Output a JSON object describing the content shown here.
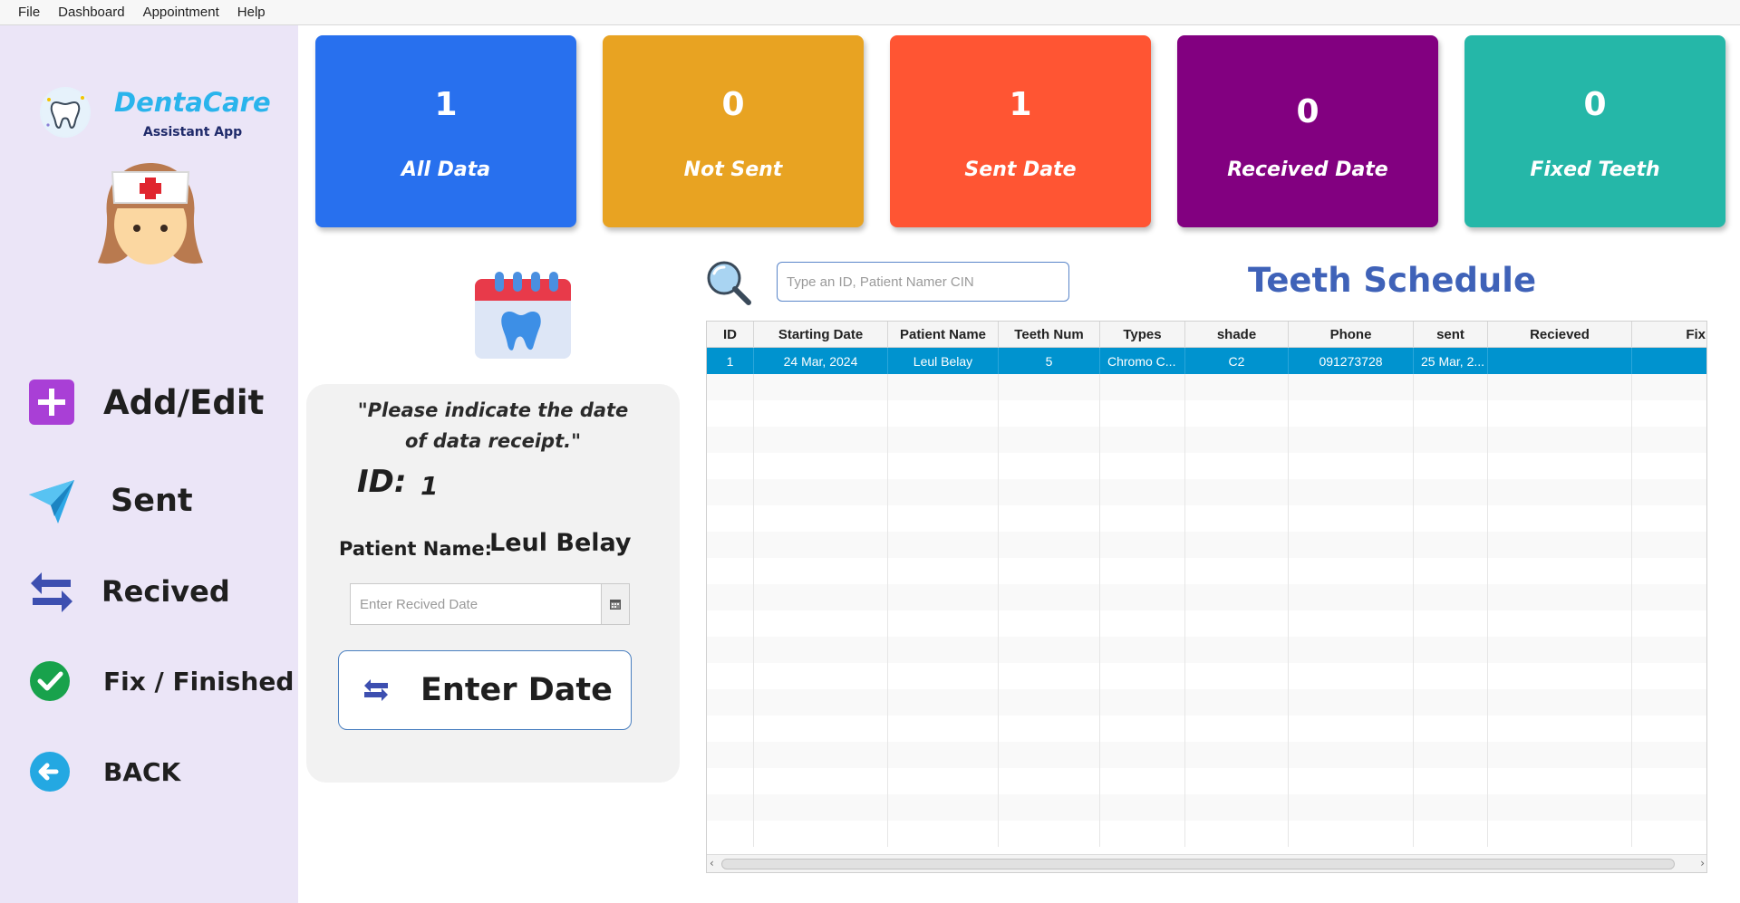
{
  "menubar": {
    "items": [
      "File",
      "Dashboard",
      "Appointment",
      "Help"
    ]
  },
  "brand": {
    "name": "DentaCare",
    "subtitle": "Assistant App",
    "logo_icon": "tooth-icon",
    "avatar_icon": "nurse-avatar-icon"
  },
  "sidebar": {
    "items": [
      {
        "label": "Add/Edit",
        "icon": "plus-square-icon"
      },
      {
        "label": "Sent",
        "icon": "paper-plane-icon"
      },
      {
        "label": "Recived",
        "icon": "swap-arrows-icon"
      },
      {
        "label": "Fix / Finished",
        "icon": "check-circle-icon"
      },
      {
        "label": "BACK",
        "icon": "back-arrow-icon"
      }
    ]
  },
  "cards": [
    {
      "count": "1",
      "label": "All Data",
      "color": "#2870ee"
    },
    {
      "count": "0",
      "label": "Not Sent",
      "color": "#e8a322"
    },
    {
      "count": "1",
      "label": "Sent Date",
      "color": "#ff5533"
    },
    {
      "count": "0",
      "label": "Received Date",
      "color": "#820080"
    },
    {
      "count": "0",
      "label": "Fixed Teeth",
      "color": "#25b7a8"
    }
  ],
  "form": {
    "prompt": "\"Please indicate the date of data receipt.\"",
    "id_label": "ID:",
    "id_value": "1",
    "patient_label": "Patient Name:",
    "patient_value": "Leul Belay",
    "date_value": "",
    "date_placeholder": "Enter Recived Date",
    "enter_button": "Enter Date"
  },
  "search": {
    "value": "",
    "placeholder": "Type an ID, Patient Namer CIN"
  },
  "table": {
    "title": "Teeth Schedule",
    "columns": [
      "ID",
      "Starting Date",
      "Patient Name",
      "Teeth Num",
      "Types",
      "shade",
      "Phone",
      "sent",
      "Recieved",
      "Fix"
    ],
    "rows": [
      [
        "1",
        "24 Mar, 2024",
        "Leul Belay",
        "5",
        "Chromo C...",
        "C2",
        "091273728",
        "25 Mar, 2...",
        "",
        ""
      ]
    ],
    "selected_row": 0
  },
  "colors": {
    "sidebar_bg": "#ebe5f7",
    "accent": "#3f62b8",
    "selection": "#0093cf",
    "brand": "#2ab4ec"
  }
}
